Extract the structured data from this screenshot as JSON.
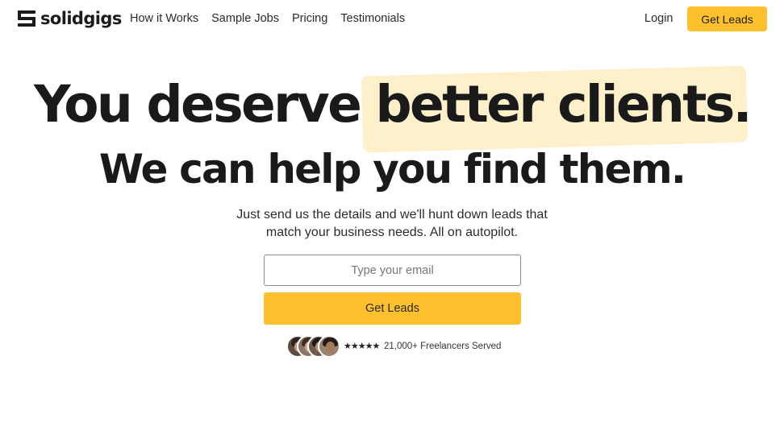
{
  "brand": {
    "name": "solidgigs"
  },
  "nav": {
    "links": [
      "How it Works",
      "Sample Jobs",
      "Pricing",
      "Testimonials"
    ],
    "login": "Login",
    "cta": "Get Leads"
  },
  "hero": {
    "headline_plain": "You deserve ",
    "headline_highlight": "better clients.",
    "subheadline": "We can help you find them.",
    "description_line1": "Just send us the details and we'll hunt down leads that",
    "description_line2": "match your business needs. All on autopilot.",
    "email_placeholder": "Type your email",
    "cta": "Get Leads"
  },
  "social_proof": {
    "stars": "★★★★★",
    "rating": 4.5,
    "text": "21,000+ Freelancers Served"
  },
  "colors": {
    "accent": "#ffc02e",
    "highlight": "#fff0cc",
    "text": "#1a1a1a"
  }
}
